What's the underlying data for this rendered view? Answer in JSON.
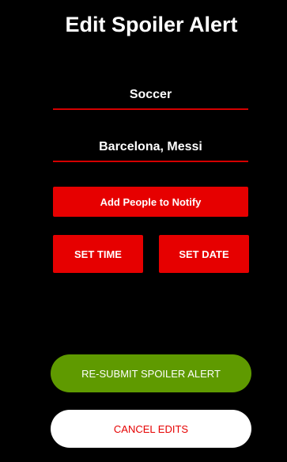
{
  "header": {
    "title": "Edit Spoiler Alert"
  },
  "form": {
    "sport_value": "Soccer",
    "teams_value": "Barcelona, Messi"
  },
  "buttons": {
    "add_people": "Add People to Notify",
    "set_time": "SET TIME",
    "set_date": "SET DATE",
    "resubmit": "RE-SUBMIT SPOILER ALERT",
    "cancel": "CANCEL EDITS"
  },
  "colors": {
    "background": "#000000",
    "accent_red": "#e60000",
    "underline_red": "#d40000",
    "submit_green": "#5f9a00",
    "cancel_bg": "#ffffff"
  }
}
